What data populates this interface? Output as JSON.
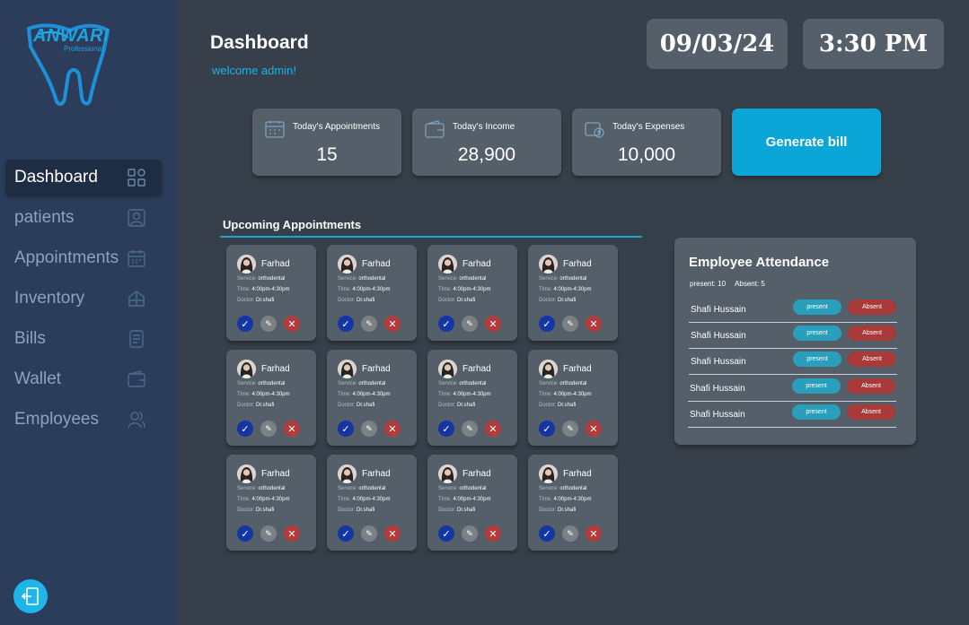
{
  "brand": {
    "name": "ANWARI",
    "tagline": "Professional"
  },
  "sidebar": {
    "items": [
      {
        "label": "Dashboard",
        "icon": "grid-icon",
        "active": true
      },
      {
        "label": "patients",
        "icon": "person-icon"
      },
      {
        "label": "Appointments",
        "icon": "calendar-icon"
      },
      {
        "label": "Inventory",
        "icon": "box-icon"
      },
      {
        "label": "Bills",
        "icon": "receipt-icon"
      },
      {
        "label": "Wallet",
        "icon": "wallet-icon"
      },
      {
        "label": "Employees",
        "icon": "users-icon"
      }
    ],
    "logout_icon": "logout-icon"
  },
  "header": {
    "title": "Dashboard",
    "welcome": "welcome admin!",
    "date": "09/03/24",
    "time": "3:30 PM"
  },
  "stats": [
    {
      "label": "Today's Appointments",
      "value": "15",
      "icon": "calendar-icon"
    },
    {
      "label": "Today's Income",
      "value": "28,900",
      "icon": "wallet-icon"
    },
    {
      "label": "Today's Expenses",
      "value": "10,000",
      "icon": "expense-icon"
    }
  ],
  "generate_bill": "Generate bill",
  "upcoming": {
    "title": "Upcoming Appointments",
    "labels": {
      "service": "Service:",
      "time": "Time:",
      "doctor": "Doctor:"
    },
    "cards": [
      {
        "name": "Farhad",
        "service": "orthodental",
        "time": "4:00pm-4:30pm",
        "doctor": "Dr.shafi"
      },
      {
        "name": "Farhad",
        "service": "orthodental",
        "time": "4:00pm-4:30pm",
        "doctor": "Dr.shafi"
      },
      {
        "name": "Farhad",
        "service": "orthodental",
        "time": "4:00pm-4:30pm",
        "doctor": "Dr.shafi"
      },
      {
        "name": "Farhad",
        "service": "orthodental",
        "time": "4:00pm-4:30pm",
        "doctor": "Dr.shafi"
      },
      {
        "name": "Farhad",
        "service": "orthodental",
        "time": "4:00pm-4:30pm",
        "doctor": "Dr.shafi"
      },
      {
        "name": "Farhad",
        "service": "orthodental",
        "time": "4:00pm-4:30pm",
        "doctor": "Dr.shafi"
      },
      {
        "name": "Farhad",
        "service": "orthodental",
        "time": "4:00pm-4:30pm",
        "doctor": "Dr.shafi"
      },
      {
        "name": "Farhad",
        "service": "orthodental",
        "time": "4:00pm-4:30pm",
        "doctor": "Dr.shafi"
      },
      {
        "name": "Farhad",
        "service": "orthodental",
        "time": "4:00pm-4:30pm",
        "doctor": "Dr.shafi"
      },
      {
        "name": "Farhad",
        "service": "orthodental",
        "time": "4:00pm-4:30pm",
        "doctor": "Dr.shafi"
      },
      {
        "name": "Farhad",
        "service": "orthodental",
        "time": "4:00pm-4:30pm",
        "doctor": "Dr.shafi"
      },
      {
        "name": "Farhad",
        "service": "orthodental",
        "time": "4:00pm-4:30pm",
        "doctor": "Dr.shafi"
      }
    ]
  },
  "attendance": {
    "title": "Employee Attendance",
    "present_count": "present: 10",
    "absent_count": "Absent: 5",
    "present_label": "present",
    "absent_label": "Absent",
    "rows": [
      {
        "name": "Shafi Hussain"
      },
      {
        "name": "Shafi Hussain"
      },
      {
        "name": "Shafi Hussain"
      },
      {
        "name": "Shafi Hussain"
      },
      {
        "name": "Shafi Hussain"
      }
    ]
  },
  "colors": {
    "accent": "#0aa6d8",
    "sidebar": "#2b3d5a",
    "background": "#37404a",
    "card": "#545f6a",
    "confirm": "#1436a4",
    "edit": "#7c8186",
    "cancel": "#b33b3b"
  }
}
